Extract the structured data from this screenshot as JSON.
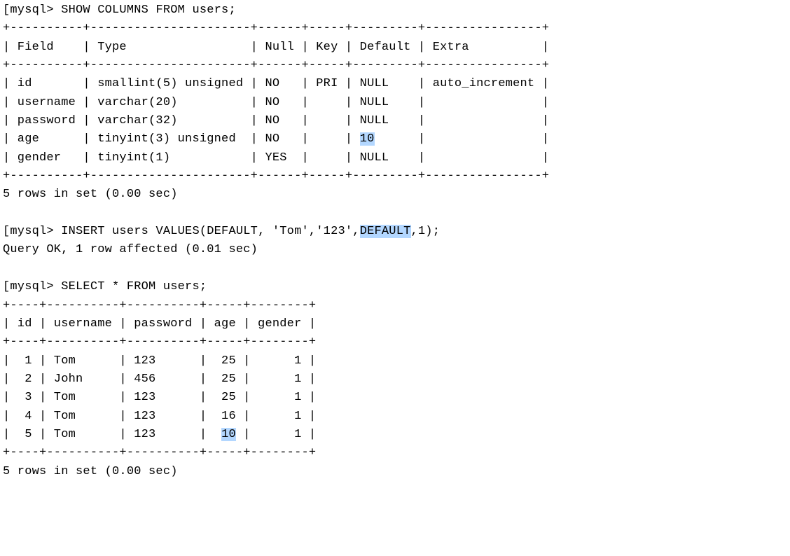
{
  "block1": {
    "prompt": "[mysql>",
    "query": "SHOW COLUMNS FROM users;",
    "borderTop": "+----------+----------------------+------+-----+---------+----------------+",
    "header": "| Field    | Type                 | Null | Key | Default | Extra          |",
    "borderMid": "+----------+----------------------+------+-----+---------+----------------+",
    "rows": [
      "| id       | smallint(5) unsigned | NO   | PRI | NULL    | auto_increment |",
      "| username | varchar(20)          | NO   |     | NULL    |                |",
      "| password | varchar(32)          | NO   |     | NULL    |                |",
      "",
      "| gender   | tinyint(1)           | YES  |     | NULL    |                |"
    ],
    "row3": {
      "a": "| age      | tinyint(3) unsigned  | NO   |     | ",
      "hl": "10",
      "b": "      |                |"
    },
    "borderBot": "+----------+----------------------+------+-----+---------+----------------+",
    "summary": "5 rows in set (0.00 sec)"
  },
  "block2": {
    "prompt": "[mysql>",
    "query": {
      "a": "INSERT users VALUES(DEFAULT, 'Tom','123',",
      "hl": "DEFAULT",
      "b": ",1);"
    },
    "result": "Query OK, 1 row affected (0.01 sec)"
  },
  "block3": {
    "prompt": "[mysql>",
    "query": "SELECT * FROM users;",
    "borderTop": "+----+----------+----------+-----+--------+",
    "header": "| id | username | password | age | gender |",
    "borderMid": "+----+----------+----------+-----+--------+",
    "rows": [
      "|  1 | Tom      | 123      |  25 |      1 |",
      "|  2 | John     | 456      |  25 |      1 |",
      "|  3 | Tom      | 123      |  25 |      1 |",
      "|  4 | Tom      | 123      |  16 |      1 |"
    ],
    "row4": {
      "a": "|  5 | Tom      | 123      |  ",
      "hl": "10",
      "b": " |      1 |"
    },
    "borderBot": "+----+----------+----------+-----+--------+",
    "summary": "5 rows in set (0.00 sec)"
  }
}
